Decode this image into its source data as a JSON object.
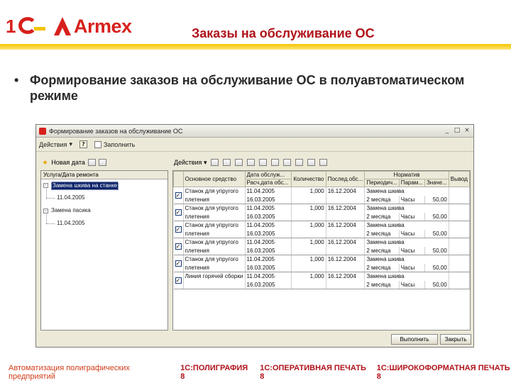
{
  "slide": {
    "title": "Заказы на обслуживание ОС",
    "bullet_mark": "•",
    "bullet": "Формирование заказов на обслуживание ОС в полуавтоматическом режиме",
    "logos": {
      "onec": "1С",
      "armex": "Armex"
    },
    "footer": {
      "base": "Автоматизация полиграфических предприятий",
      "products": [
        "1С:ПОЛИГРАФИЯ 8",
        "1С:ОПЕРАТИВНАЯ ПЕЧАТЬ 8",
        "1С:ШИРОКОФОРМАТНАЯ ПЕЧАТЬ 8"
      ]
    },
    "brand_red": "#b0131a",
    "accent_yellow": "#f6c500"
  },
  "window": {
    "title": "Формирование заказов на обслуживание ОС",
    "controls": [
      "_",
      "□",
      "×"
    ],
    "toolbar": {
      "actions": "Действия",
      "help": "?",
      "fill": "Заполнить"
    },
    "left": {
      "new_label": "Новая дата",
      "tree_header": "Услуга/Дата ремонта",
      "nodes": [
        "Замена шкива на станке",
        "11.04.2005",
        "Замена пасика",
        "11.04.2005"
      ]
    },
    "right": {
      "actions": "Действия",
      "columns": {
        "main": "Основное средство",
        "date": "Дата обслуж...",
        "date2": "Расч.дата обс...",
        "qty": "Количество",
        "last": "Послед.обс...",
        "norm": "Норматив",
        "period": "Периодич...",
        "param": "Парам...",
        "value": "Значе...",
        "next": "Вывод"
      },
      "rows": [
        {
          "checked": "✓",
          "name1": "Станок для упругого",
          "name2": "плетения",
          "date": "11.04.2005",
          "date2": "16.03.2005",
          "qty": "1,000",
          "last": "16.12.2004",
          "norm": "Замена шкива",
          "period": "2 месяца",
          "param": "Часы",
          "value": "50,00"
        },
        {
          "checked": "✓",
          "name1": "Станок для упругого",
          "name2": "плетения",
          "date": "11.04.2005",
          "date2": "16.03.2005",
          "qty": "1,000",
          "last": "16.12.2004",
          "norm": "Замена шкива",
          "period": "2 месяца",
          "param": "Часы",
          "value": "50,00"
        },
        {
          "checked": "✓",
          "name1": "Станок для упругого",
          "name2": "плетения",
          "date": "11.04.2005",
          "date2": "16.03.2005",
          "qty": "1,000",
          "last": "16.12.2004",
          "norm": "Замена шкива",
          "period": "2 месяца",
          "param": "Часы",
          "value": "50,00"
        },
        {
          "checked": "✓",
          "name1": "Станок для упругого",
          "name2": "плетения",
          "date": "11.04.2005",
          "date2": "16.03.2005",
          "qty": "1,000",
          "last": "16.12.2004",
          "norm": "Замена шкива",
          "period": "2 месяца",
          "param": "Часы",
          "value": "50,00"
        },
        {
          "checked": "✓",
          "name1": "Станок для упругого",
          "name2": "плетения",
          "date": "11.04.2005",
          "date2": "16.03.2005",
          "qty": "1,000",
          "last": "16.12.2004",
          "norm": "Замена шкива",
          "period": "2 месяца",
          "param": "Часы",
          "value": "50,00"
        },
        {
          "checked": "✓",
          "name1": "Линия горячей сборки",
          "name2": "",
          "date": "11.04.2005",
          "date2": "16.03.2005",
          "qty": "1,000",
          "last": "16.12.2004",
          "norm": "Замена шкива",
          "period": "2 месяца",
          "param": "Часы",
          "value": "50,00"
        }
      ]
    },
    "buttons": {
      "run": "Выполнить",
      "close": "Закрыть"
    }
  }
}
